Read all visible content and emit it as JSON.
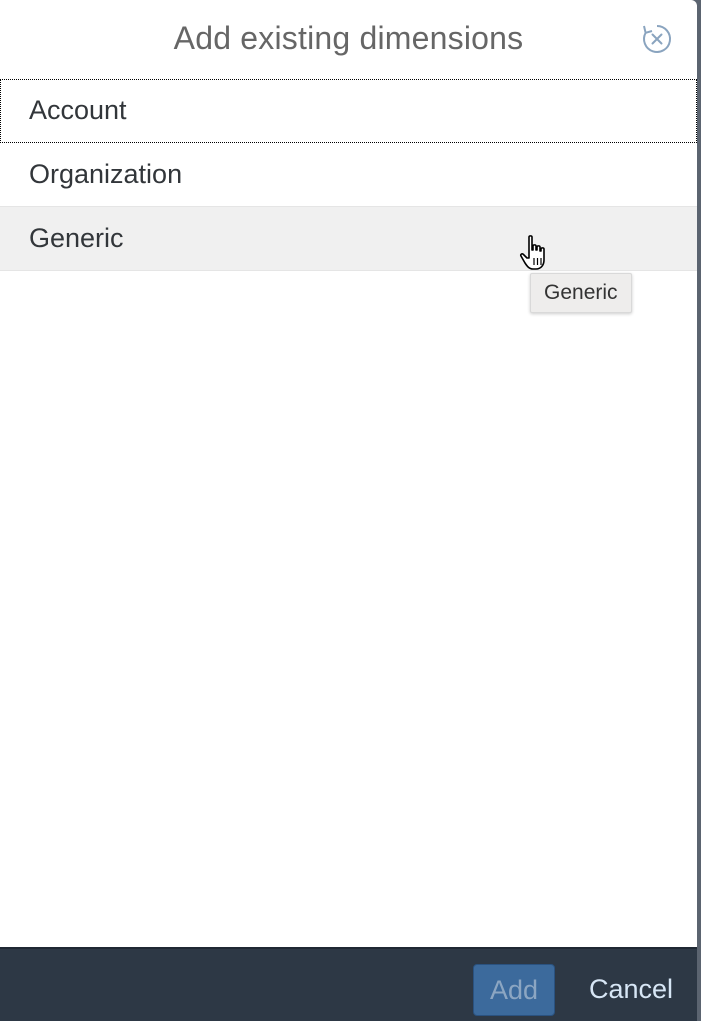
{
  "dialog": {
    "title": "Add existing dimensions",
    "close_icon": "close-reset-icon"
  },
  "list": {
    "items": [
      {
        "label": "Account",
        "state": "focused"
      },
      {
        "label": "Organization",
        "state": "normal"
      },
      {
        "label": "Generic",
        "state": "hovered"
      }
    ]
  },
  "tooltip": {
    "text": "Generic"
  },
  "footer": {
    "add_label": "Add",
    "cancel_label": "Cancel"
  },
  "colors": {
    "footer_bg": "#2d3845",
    "primary_button": "#3c6a9c",
    "hover_row": "#f0f0f0",
    "title_text": "#666666"
  }
}
